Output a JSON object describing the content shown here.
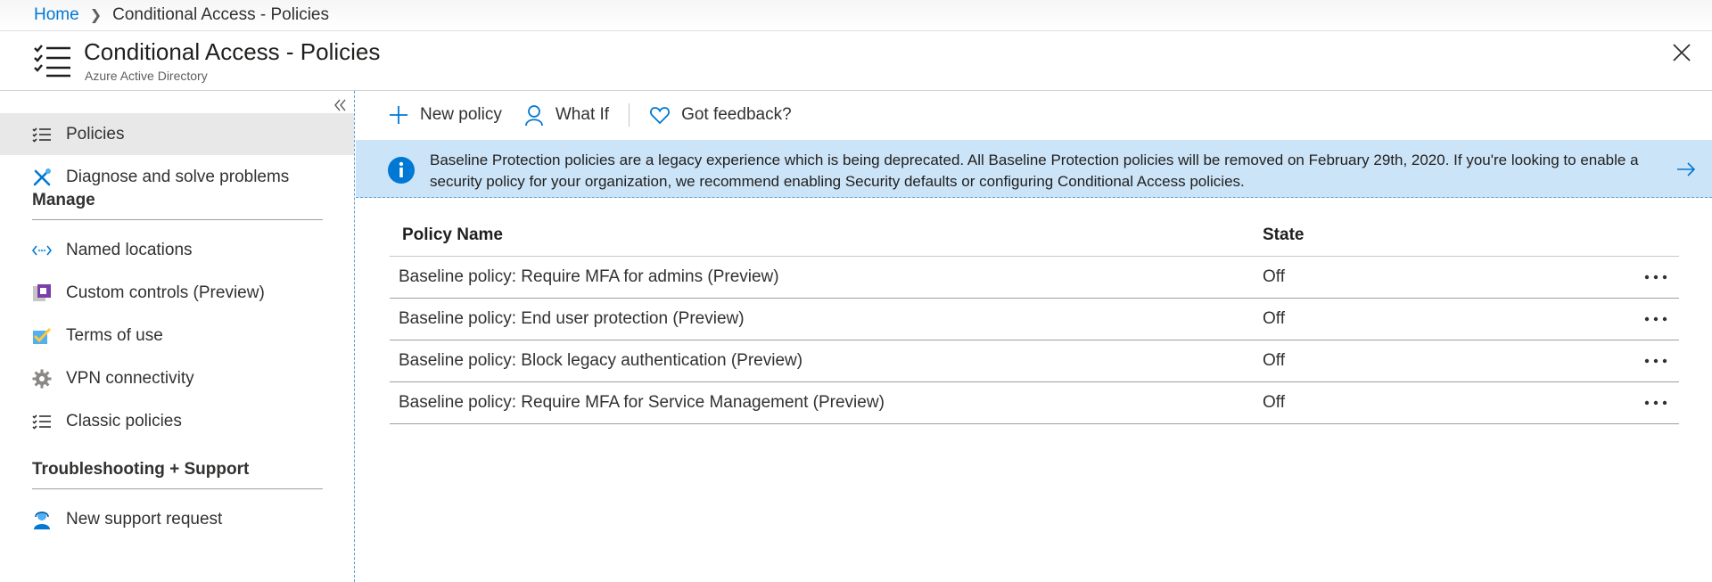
{
  "breadcrumb": {
    "home": "Home",
    "current": "Conditional Access - Policies"
  },
  "header": {
    "title": "Conditional Access - Policies",
    "subtitle": "Azure Active Directory"
  },
  "sidebar": {
    "items": [
      {
        "label": "Policies",
        "icon": "list-icon"
      },
      {
        "label": "Diagnose and solve problems",
        "icon": "tools-icon"
      }
    ],
    "manage_header": "Manage",
    "manage_items": [
      {
        "label": "Named locations",
        "icon": "named-locations-icon"
      },
      {
        "label": "Custom controls (Preview)",
        "icon": "custom-controls-icon"
      },
      {
        "label": "Terms of use",
        "icon": "checkbox-icon"
      },
      {
        "label": "VPN connectivity",
        "icon": "gear-icon"
      },
      {
        "label": "Classic policies",
        "icon": "list-icon"
      }
    ],
    "support_header": "Troubleshooting + Support",
    "support_items": [
      {
        "label": "New support request",
        "icon": "support-person-icon"
      }
    ]
  },
  "toolbar": {
    "new_policy": "New policy",
    "what_if": "What If",
    "feedback": "Got feedback?"
  },
  "banner": {
    "message": "Baseline Protection policies are a legacy experience which is being deprecated. All Baseline Protection policies will be removed on February 29th, 2020. If you're looking to enable a security policy for your organization, we recommend enabling Security defaults or configuring Conditional Access policies."
  },
  "table": {
    "columns": [
      "Policy Name",
      "State"
    ],
    "rows": [
      {
        "name": "Baseline policy: Require MFA for admins (Preview)",
        "state": "Off"
      },
      {
        "name": "Baseline policy: End user protection (Preview)",
        "state": "Off"
      },
      {
        "name": "Baseline policy: Block legacy authentication (Preview)",
        "state": "Off"
      },
      {
        "name": "Baseline policy: Require MFA for Service Management (Preview)",
        "state": "Off"
      }
    ]
  },
  "colors": {
    "accent": "#0078d4",
    "banner_bg": "#cce4f7",
    "selected_nav": "#e8e8e8"
  }
}
